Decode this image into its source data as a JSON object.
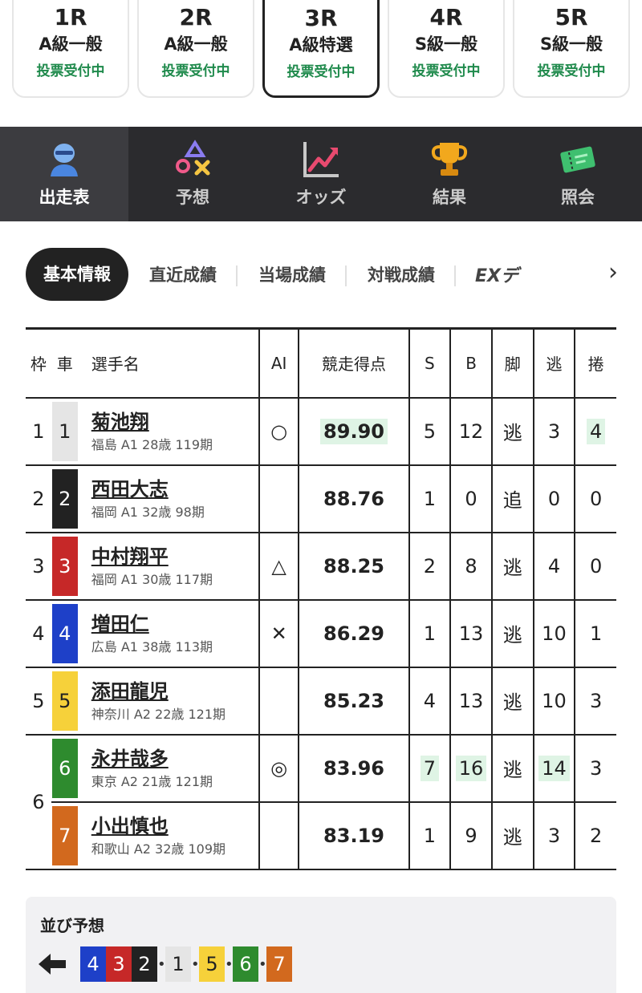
{
  "race_tabs": [
    {
      "num": "1R",
      "grade": "A級一般",
      "status": "投票受付中",
      "active": false
    },
    {
      "num": "2R",
      "grade": "A級一般",
      "status": "投票受付中",
      "active": false
    },
    {
      "num": "3R",
      "grade": "A級特選",
      "status": "投票受付中",
      "active": true
    },
    {
      "num": "4R",
      "grade": "S級一般",
      "status": "投票受付中",
      "active": false
    },
    {
      "num": "5R",
      "grade": "S級一般",
      "status": "投票受付中",
      "active": false
    }
  ],
  "nav": [
    {
      "label": "出走表",
      "icon": "helmet-icon",
      "active": true
    },
    {
      "label": "予想",
      "icon": "shapes-icon",
      "active": false
    },
    {
      "label": "オッズ",
      "icon": "chart-line-icon",
      "active": false
    },
    {
      "label": "結果",
      "icon": "trophy-icon",
      "active": false
    },
    {
      "label": "照会",
      "icon": "ticket-icon",
      "active": false
    }
  ],
  "subtabs": {
    "active": "基本情報",
    "items": [
      "直近成績",
      "当場成績",
      "対戦成績"
    ],
    "ext": "EXデ"
  },
  "table": {
    "headers": {
      "waku": "枠",
      "sha": "車",
      "name": "選手名",
      "ai": "AI",
      "score": "競走得点",
      "s": "S",
      "b": "B",
      "kyaku": "脚",
      "nige": "逃",
      "makuri": "捲"
    },
    "rows": [
      {
        "waku": "1",
        "sha": "1",
        "name": "菊池翔",
        "info": "福島 A1 28歳 119期",
        "ai": "○",
        "score": "89.90",
        "s": "5",
        "b": "12",
        "kyaku": "逃",
        "nige": "3",
        "makuri": "4"
      },
      {
        "waku": "2",
        "sha": "2",
        "name": "西田大志",
        "info": "福岡 A1 32歳 98期",
        "ai": "",
        "score": "88.76",
        "s": "1",
        "b": "0",
        "kyaku": "追",
        "nige": "0",
        "makuri": "0"
      },
      {
        "waku": "3",
        "sha": "3",
        "name": "中村翔平",
        "info": "福岡 A1 30歳 117期",
        "ai": "△",
        "score": "88.25",
        "s": "2",
        "b": "8",
        "kyaku": "逃",
        "nige": "4",
        "makuri": "0"
      },
      {
        "waku": "4",
        "sha": "4",
        "name": "増田仁",
        "info": "広島 A1 38歳 113期",
        "ai": "✕",
        "score": "86.29",
        "s": "1",
        "b": "13",
        "kyaku": "逃",
        "nige": "10",
        "makuri": "1"
      },
      {
        "waku": "5",
        "sha": "5",
        "name": "添田龍児",
        "info": "神奈川 A2 22歳 121期",
        "ai": "",
        "score": "85.23",
        "s": "4",
        "b": "13",
        "kyaku": "逃",
        "nige": "10",
        "makuri": "3"
      },
      {
        "waku": "6",
        "sha": "6",
        "name": "永井哉多",
        "info": "東京 A2 21歳 121期",
        "ai": "◎",
        "score": "83.96",
        "s": "7",
        "b": "16",
        "kyaku": "逃",
        "nige": "14",
        "makuri": "3"
      },
      {
        "waku": "",
        "sha": "7",
        "name": "小出慎也",
        "info": "和歌山 A2 32歳 109期",
        "ai": "",
        "score": "83.19",
        "s": "1",
        "b": "9",
        "kyaku": "逃",
        "nige": "3",
        "makuri": "2"
      }
    ]
  },
  "bike_colors": {
    "1": {
      "bg": "#e5e5e5",
      "fg": "#222222"
    },
    "2": {
      "bg": "#222222",
      "fg": "#ffffff"
    },
    "3": {
      "bg": "#c62828",
      "fg": "#ffffff"
    },
    "4": {
      "bg": "#1e40c8",
      "fg": "#ffffff"
    },
    "5": {
      "bg": "#f6d13a",
      "fg": "#222222"
    },
    "6": {
      "bg": "#2e8b2e",
      "fg": "#ffffff"
    },
    "7": {
      "bg": "#d2691e",
      "fg": "#ffffff"
    }
  },
  "highlight_color": "#dff4e5",
  "line_prediction": {
    "title": "並び予想",
    "groups": [
      [
        "4",
        "3",
        "2"
      ],
      [
        "1"
      ],
      [
        "5"
      ],
      [
        "6"
      ],
      [
        "7"
      ]
    ]
  }
}
